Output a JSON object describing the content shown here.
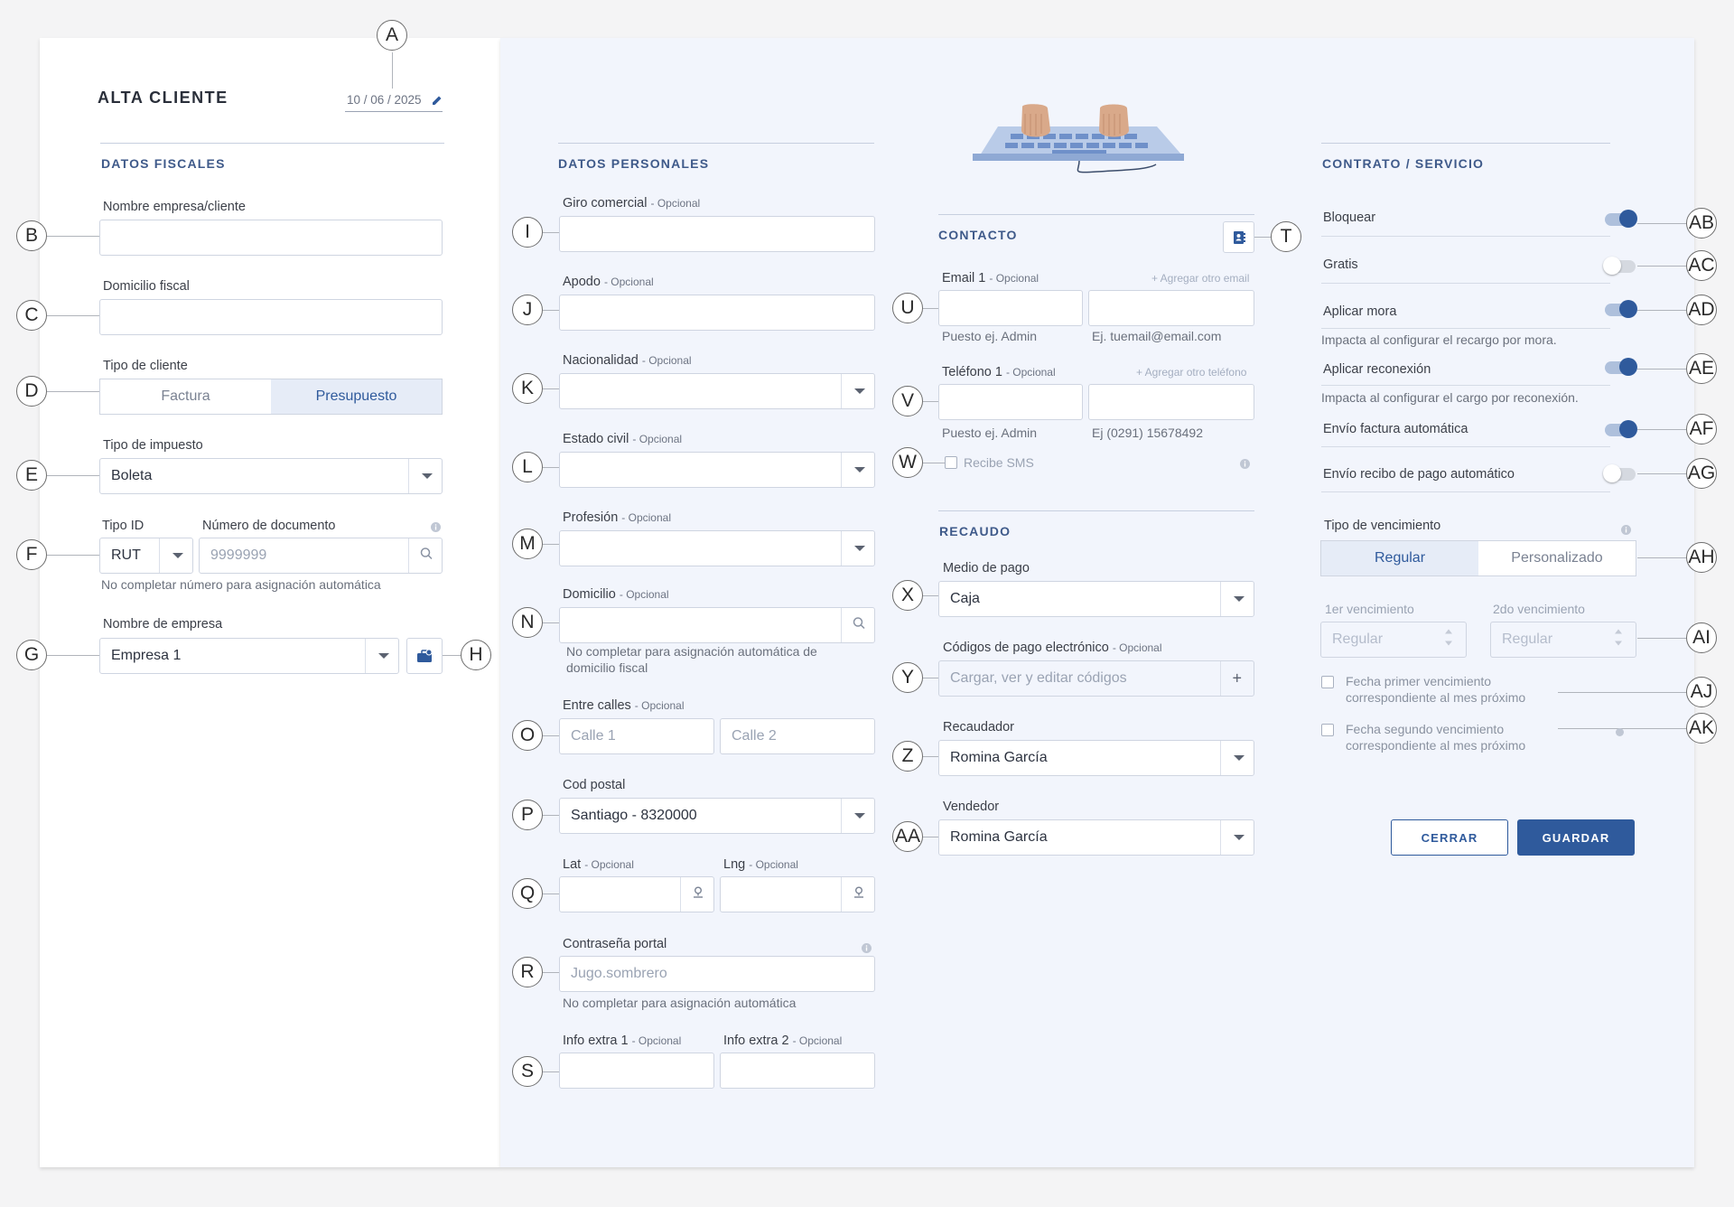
{
  "form": {
    "title": "ALTA CLIENTE",
    "date": "10 / 06 / 2025",
    "icons": {
      "edit_date": "pencil-icon",
      "contacts": "address-book-icon",
      "company": "briefcase-icon"
    }
  },
  "markers": [
    "A",
    "B",
    "C",
    "D",
    "E",
    "F",
    "G",
    "H",
    "I",
    "J",
    "K",
    "L",
    "M",
    "N",
    "O",
    "P",
    "Q",
    "R",
    "S",
    "T",
    "U",
    "V",
    "W",
    "X",
    "Y",
    "Z",
    "AA",
    "AB",
    "AC",
    "AD",
    "AE",
    "AF",
    "AG",
    "AH",
    "AI",
    "AJ",
    "AK"
  ],
  "fiscal": {
    "section_title": "DATOS FISCALES",
    "company_name_label": "Nombre empresa/cliente",
    "fiscal_address_label": "Domicilio fiscal",
    "client_type_label": "Tipo de cliente",
    "client_type_options": [
      "Factura",
      "Presupuesto"
    ],
    "client_type_selected": "Presupuesto",
    "tax_type_label": "Tipo de impuesto",
    "tax_type_value": "Boleta",
    "id_type_label": "Tipo ID",
    "id_type_value": "RUT",
    "doc_number_label": "Número de documento",
    "doc_number_placeholder": "9999999",
    "doc_hint": "No completar número para asignación automática",
    "company_label": "Nombre de empresa",
    "company_value": "Empresa 1"
  },
  "personal": {
    "section_title": "DATOS PERSONALES",
    "optional": "- Opcional",
    "giro_label": "Giro comercial",
    "apodo_label": "Apodo",
    "nacionalidad_label": "Nacionalidad",
    "estado_civil_label": "Estado civil",
    "profesion_label": "Profesión",
    "domicilio_label": "Domicilio",
    "domicilio_hint": "No completar para asignación automática de domicilio fiscal",
    "entre_calles_label": "Entre calles",
    "calle1_placeholder": "Calle 1",
    "calle2_placeholder": "Calle 2",
    "cod_postal_label": "Cod postal",
    "cod_postal_value": "Santiago - 8320000",
    "lat_label": "Lat",
    "lng_label": "Lng",
    "password_label": "Contraseña portal",
    "password_placeholder": "Jugo.sombrero",
    "password_hint": "No completar para asignación automática",
    "extra1_label": "Info extra 1",
    "extra2_label": "Info extra 2"
  },
  "contact": {
    "section_title": "CONTACTO",
    "email_label": "Email 1",
    "add_email": "+ Agregar otro email",
    "email_role_hint": "Puesto ej. Admin",
    "email_example": "Ej. tuemail@email.com",
    "phone_label": "Teléfono 1",
    "add_phone": "+ Agregar otro teléfono",
    "phone_role_hint": "Puesto ej. Admin",
    "phone_example": "Ej (0291) 15678492",
    "sms_label": "Recibe SMS",
    "sms_checked": false
  },
  "collection": {
    "section_title": "RECAUDO",
    "payment_method_label": "Medio de pago",
    "payment_method_value": "Caja",
    "codes_label": "Códigos de pago electrónico",
    "codes_placeholder": "Cargar, ver y editar códigos",
    "collector_label": "Recaudador",
    "collector_value": "Romina García",
    "seller_label": "Vendedor",
    "seller_value": "Romina García"
  },
  "contract": {
    "section_title": "CONTRATO / SERVICIO",
    "toggles": [
      {
        "label": "Bloquear",
        "on": true
      },
      {
        "label": "Gratis",
        "on": false
      },
      {
        "label": "Aplicar mora",
        "on": true,
        "hint": "Impacta al configurar el recargo por mora."
      },
      {
        "label": "Aplicar reconexión",
        "on": true,
        "hint": "Impacta al configurar el cargo por reconexión."
      },
      {
        "label": "Envío factura automática",
        "on": true
      },
      {
        "label": "Envío recibo de pago automático",
        "on": false
      }
    ],
    "due_type_label": "Tipo de vencimiento",
    "due_type_options": [
      "Regular",
      "Personalizado"
    ],
    "due_type_selected": "Regular",
    "first_due_label": "1er vencimiento",
    "second_due_label": "2do vencimiento",
    "due_placeholder": "Regular",
    "check_first": "Fecha primer vencimiento correspondiente al mes próximo",
    "check_second": "Fecha segundo vencimiento correspondiente al mes próximo"
  },
  "actions": {
    "close": "CERRAR",
    "save": "GUARDAR"
  }
}
